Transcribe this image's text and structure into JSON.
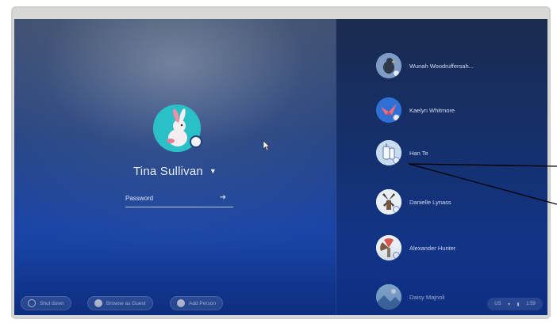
{
  "selected_user": {
    "name": "Tina Sullivan",
    "avatar_icon": "rabbit-avatar-icon",
    "avatar_color": "#2bbfc7"
  },
  "password": {
    "placeholder": "Password",
    "value": ""
  },
  "users": [
    {
      "name": "Wunah Woodruffersah...",
      "avatar_icon": "bird-avatar-icon",
      "avatar_bg": "#7e9cc6"
    },
    {
      "name": "Kaelyn Whitmore",
      "avatar_icon": "origami-bird-avatar-icon",
      "avatar_bg": "#2f6fd6"
    },
    {
      "name": "Han Te",
      "avatar_icon": "drink-avatar-icon",
      "avatar_bg": "#c9dcef"
    },
    {
      "name": "Danielle Lynass",
      "avatar_icon": "windmill-avatar-icon",
      "avatar_bg": "#e9eff4"
    },
    {
      "name": "Alexander Hunter",
      "avatar_icon": "fan-avatar-icon",
      "avatar_bg": "#e9eff4"
    },
    {
      "name": "Daisy Majnoli",
      "avatar_icon": "landscape-avatar-icon",
      "avatar_bg": "#9bc4e8"
    }
  ],
  "shelf": {
    "shut_down": "Shut down",
    "browse_as_guest": "Browse as Guest",
    "add_person": "Add Person"
  },
  "status_tray": {
    "locale": "US",
    "time": "1:59"
  }
}
